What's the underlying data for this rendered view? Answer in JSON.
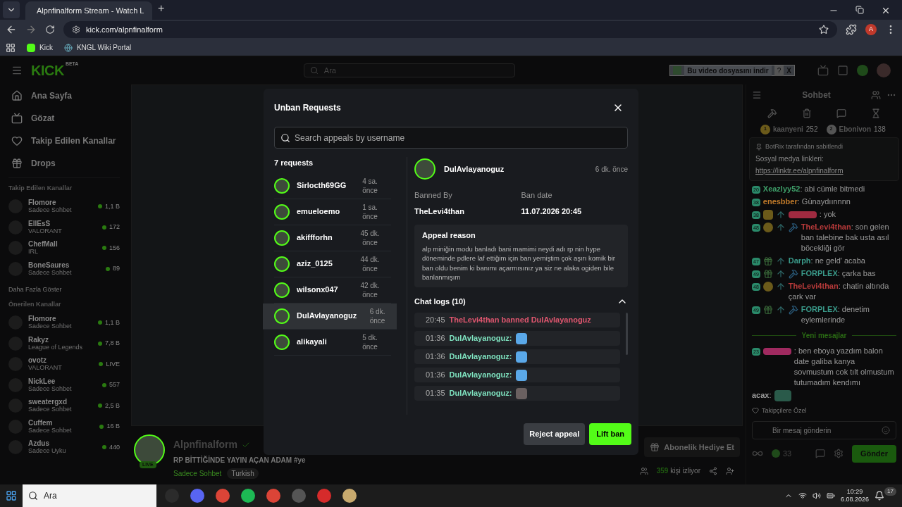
{
  "browser": {
    "tab_title": "Alpnfinalform Stream - Watch L",
    "new_tab": "+",
    "url": "kick.com/alpnfinalform",
    "profile_initial": "A",
    "bookmarks": [
      "Kick",
      "KNGL Wiki Portal"
    ]
  },
  "header": {
    "logo": "KICK",
    "logo_tag": "BETA",
    "search_placeholder": "Ara",
    "download_bar": "Bu video dosyasını indir",
    "download_help": "?",
    "download_close": "X"
  },
  "sidebar": {
    "nav": [
      "Ana Sayfa",
      "Gözat",
      "Takip Edilen Kanallar",
      "Drops"
    ],
    "followed_title": "Takip Edilen Kanallar",
    "followed": [
      {
        "name": "Flomore",
        "category": "Sadece Sohbet",
        "viewers": "1,1 B"
      },
      {
        "name": "EllEsS",
        "category": "VALORANT",
        "viewers": "172"
      },
      {
        "name": "ChefMall",
        "category": "IRL",
        "viewers": "156"
      },
      {
        "name": "BoneSaures",
        "category": "Sadece Sohbet",
        "viewers": "89"
      }
    ],
    "show_more": "Daha Fazla Göster",
    "recommended_title": "Önerilen Kanallar",
    "recommended": [
      {
        "name": "Flomore",
        "category": "Sadece Sohbet",
        "viewers": "1,1 B"
      },
      {
        "name": "Rakyz",
        "category": "League of Legends",
        "viewers": "7,8 B"
      },
      {
        "name": "ovotz",
        "category": "VALORANT",
        "viewers": "LIVE"
      },
      {
        "name": "NickLee",
        "category": "Sadece Sohbet",
        "viewers": "557"
      },
      {
        "name": "sweatergxd",
        "category": "Sadece Sohbet",
        "viewers": "2,5 B"
      },
      {
        "name": "Cuffem",
        "category": "Sadece Sohbet",
        "viewers": "16 B"
      },
      {
        "name": "Azdus",
        "category": "Sadece Uyku",
        "viewers": "440"
      }
    ]
  },
  "stream": {
    "channel": "Alpnfinalform",
    "live_badge": "LIVE",
    "title": "RP BİTTİĞİNDE YAYIN AÇAN ADAM #ye",
    "category": "Sadece Sohbet",
    "tag": "Turkish",
    "gift_button": "Abonelik Hediye Et",
    "viewers": "359",
    "viewers_label": "kişi izliyor"
  },
  "chat": {
    "title": "Sohbet",
    "leaderboard": [
      {
        "rank": "1",
        "name": "kaanyeni",
        "points": "252"
      },
      {
        "rank": "2",
        "name": "Ebonivon",
        "points": "138"
      }
    ],
    "pinned": {
      "by": "BotRix tarafından sabitlendi",
      "text": "Sosyal medya linkleri:",
      "link": "https://linktr.ee/alpnfinalform"
    },
    "messages": [
      {
        "sub": "20",
        "name": "Xeazlyy52",
        "color": "#3fa06a",
        "text": ": abi cümle bitmedi"
      },
      {
        "sub": "38",
        "name": "enesbber",
        "color": "#c07a2a",
        "text": ": Günaydıınnnn"
      },
      {
        "sub": "38",
        "badges": [
          {
            "kind": "k"
          },
          {
            "kind": "arrow"
          }
        ],
        "color": "#a02a40",
        "text": ": yok"
      },
      {
        "sub": "48",
        "badges": [
          {
            "kind": "coin"
          },
          {
            "kind": "arrow"
          },
          {
            "kind": "hammer"
          }
        ],
        "name": "TheLevi4than",
        "color": "#b83a3a",
        "text": ": son gelen ban talebine bak usta asıl böcekliği gör"
      },
      {
        "sub": "47",
        "badges": [
          {
            "kind": "gift"
          },
          {
            "kind": "arrow"
          }
        ],
        "name": "Darph",
        "color": "#3a9a8a",
        "text": ": ne geld' acaba"
      },
      {
        "sub": "49",
        "badges": [
          {
            "kind": "gift"
          },
          {
            "kind": "arrow"
          },
          {
            "kind": "hammer"
          }
        ],
        "name": "FORPLEX",
        "color": "#3a9a8a",
        "text": ": çarka bas"
      },
      {
        "sub": "48",
        "badges": [
          {
            "kind": "coin"
          },
          {
            "kind": "arrow"
          }
        ],
        "name": "TheLevi4than",
        "color": "#b83a3a",
        "text": ": chatin altında çark var"
      },
      {
        "sub": "49",
        "badges": [
          {
            "kind": "gift"
          },
          {
            "kind": "arrow"
          },
          {
            "kind": "hammer"
          }
        ],
        "name": "FORPLEX",
        "color": "#3a9a8a",
        "text": ": denetim eylemlerinde"
      }
    ],
    "new_messages": "Yeni mesajlar",
    "later_messages": [
      {
        "sub": "23",
        "color": "#a02a60",
        "text": ": ben eboya yazdım balon date galiba kanya sovmustum cok tılt olmustum tutumadım kendımı"
      },
      {
        "name": "acax",
        "color": "#9a9a9a",
        "text": ":",
        "emote": true
      }
    ],
    "followers_only": "Takipçilere Özel",
    "input_placeholder": "Bir mesaj gönderin",
    "points": "33",
    "send": "Gönder"
  },
  "modal": {
    "title": "Unban Requests",
    "search_placeholder": "Search appeals by username",
    "count": "7 requests",
    "requests": [
      {
        "name": "Sirlocth69GG",
        "time": "4 sa. önce",
        "selected": false
      },
      {
        "name": "emueloemo",
        "time": "1 sa. önce",
        "selected": false
      },
      {
        "name": "akiffforhn",
        "time": "45 dk. önce",
        "selected": false
      },
      {
        "name": "aziz_0125",
        "time": "44 dk. önce",
        "selected": false
      },
      {
        "name": "wilsonx047",
        "time": "42 dk. önce",
        "selected": false
      },
      {
        "name": "DulAvlayanoguz",
        "time": "6 dk. önce",
        "selected": true
      },
      {
        "name": "alikayali",
        "time": "5 dk. önce",
        "selected": false
      }
    ],
    "detail": {
      "name": "DulAvlayanoguz",
      "time": "6 dk. önce",
      "banned_by_label": "Banned By",
      "banned_by": "TheLevi4than",
      "ban_date_label": "Ban date",
      "ban_date": "11.07.2026 20:45",
      "reason_label": "Appeal reason",
      "reason": "alp miniğin modu banladı bani mamimi neydi adı rp nin hype döneminde pdlere laf ettiğim için ban yemiştim çok aşırı komik bir ban oldu benim ki banımı açarmısınız ya siz ne alaka ogiden bile banlanmışım",
      "logs_label": "Chat logs (10)",
      "logs_expanded": true,
      "logs": [
        {
          "kind": "ban",
          "time": "20:45",
          "text": "TheLevi4than banned DulAvlayanoguz"
        },
        {
          "kind": "message",
          "time": "01:36",
          "text": "DulAvlayanoguz:",
          "color": "#5aa8e8"
        },
        {
          "kind": "message",
          "time": "01:36",
          "text": "DulAvlayanoguz:",
          "color": "#5aa8e8"
        },
        {
          "kind": "message",
          "time": "01:36",
          "text": "DulAvlayanoguz:",
          "color": "#5aa8e8"
        },
        {
          "kind": "message",
          "time": "01:35",
          "text": "DulAvlayanoguz:",
          "color": "#6a6060"
        }
      ]
    },
    "reject": "Reject appeal",
    "lift": "Lift ban"
  },
  "taskbar": {
    "search": "Ara",
    "time": "10:29",
    "date": "6.08.2026",
    "notifications": "17"
  }
}
